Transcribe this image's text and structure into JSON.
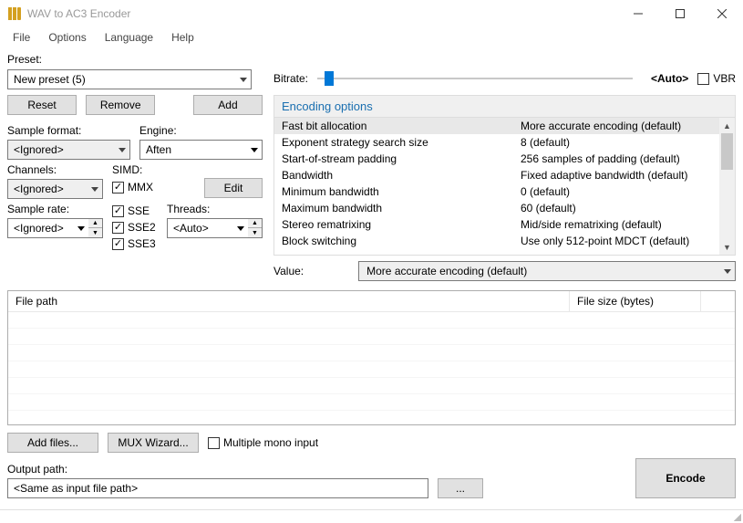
{
  "window": {
    "title": "WAV to AC3 Encoder"
  },
  "menu": [
    "File",
    "Options",
    "Language",
    "Help"
  ],
  "preset": {
    "label": "Preset:",
    "value": "New preset (5)",
    "reset": "Reset",
    "remove": "Remove",
    "add": "Add"
  },
  "left": {
    "sample_format_label": "Sample format:",
    "sample_format_value": "<Ignored>",
    "engine_label": "Engine:",
    "engine_value": "Aften",
    "channels_label": "Channels:",
    "channels_value": "<Ignored>",
    "simd_label": "SIMD:",
    "edit": "Edit",
    "simd": {
      "mmx": "MMX",
      "sse": "SSE",
      "sse2": "SSE2",
      "sse3": "SSE3"
    },
    "sample_rate_label": "Sample rate:",
    "sample_rate_value": "<Ignored>",
    "threads_label": "Threads:",
    "threads_value": "<Auto>"
  },
  "bitrate": {
    "label": "Bitrate:",
    "auto": "<Auto>",
    "vbr": "VBR"
  },
  "options": {
    "header": "Encoding options",
    "rows": [
      {
        "name": "Fast bit allocation",
        "val": "More accurate encoding (default)"
      },
      {
        "name": "Exponent strategy search size",
        "val": "8 (default)"
      },
      {
        "name": "Start-of-stream padding",
        "val": "256 samples of padding (default)"
      },
      {
        "name": "Bandwidth",
        "val": "Fixed adaptive bandwidth (default)"
      },
      {
        "name": "Minimum bandwidth",
        "val": "0 (default)"
      },
      {
        "name": "Maximum bandwidth",
        "val": "60 (default)"
      },
      {
        "name": "Stereo rematrixing",
        "val": "Mid/side rematrixing (default)"
      },
      {
        "name": "Block switching",
        "val": "Use only 512-point MDCT (default)"
      }
    ],
    "value_label": "Value:",
    "value_selected": "More accurate encoding (default)"
  },
  "filelist": {
    "col1": "File path",
    "col2": "File size (bytes)"
  },
  "bottom": {
    "add_files": "Add files...",
    "mux_wizard": "MUX Wizard...",
    "multiple_mono": "Multiple mono input"
  },
  "output": {
    "label": "Output path:",
    "value": "<Same as input file path>",
    "browse": "...",
    "encode": "Encode"
  }
}
